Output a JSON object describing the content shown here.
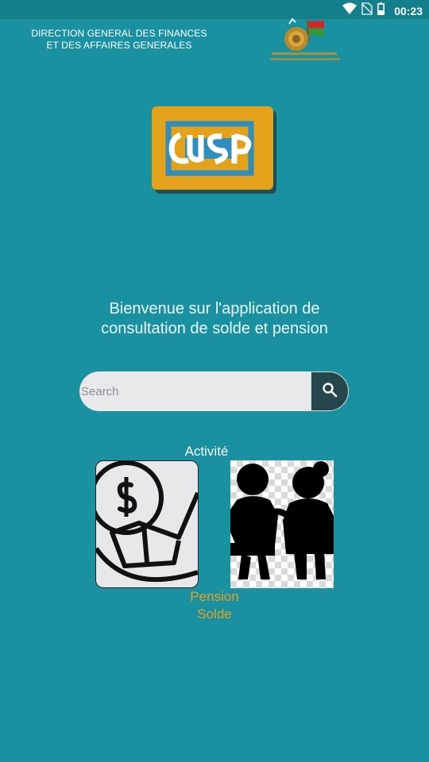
{
  "status_bar": {
    "time": "00:23",
    "icons": [
      "wifi-icon",
      "no-sim-icon",
      "battery-icon"
    ]
  },
  "header": {
    "organization_line1": "DIRECTION GENERAL DES FINANCES",
    "organization_line2": "ET DES AFFAIRES GENERALES",
    "emblem": "madagascar-emblem-logo"
  },
  "app_logo": {
    "icon": "cusp-logo",
    "background_color": "#e3a219"
  },
  "welcome": {
    "line1": "Bienvenue sur l'application de",
    "line2": "consultation de solde et pension"
  },
  "search": {
    "placeholder": "Search",
    "value": "",
    "button_icon": "search-icon"
  },
  "categories": {
    "activite_label": "Activité",
    "pension_label": "Pension",
    "solde_label": "Solde",
    "pension_icon": "rocking-chair-money-icon",
    "solde_icon": "elderly-couple-icon"
  },
  "colors": {
    "background": "#1a91a1",
    "status_bar": "#157e8b",
    "accent": "#e5a21f",
    "search_button": "#25474c"
  }
}
